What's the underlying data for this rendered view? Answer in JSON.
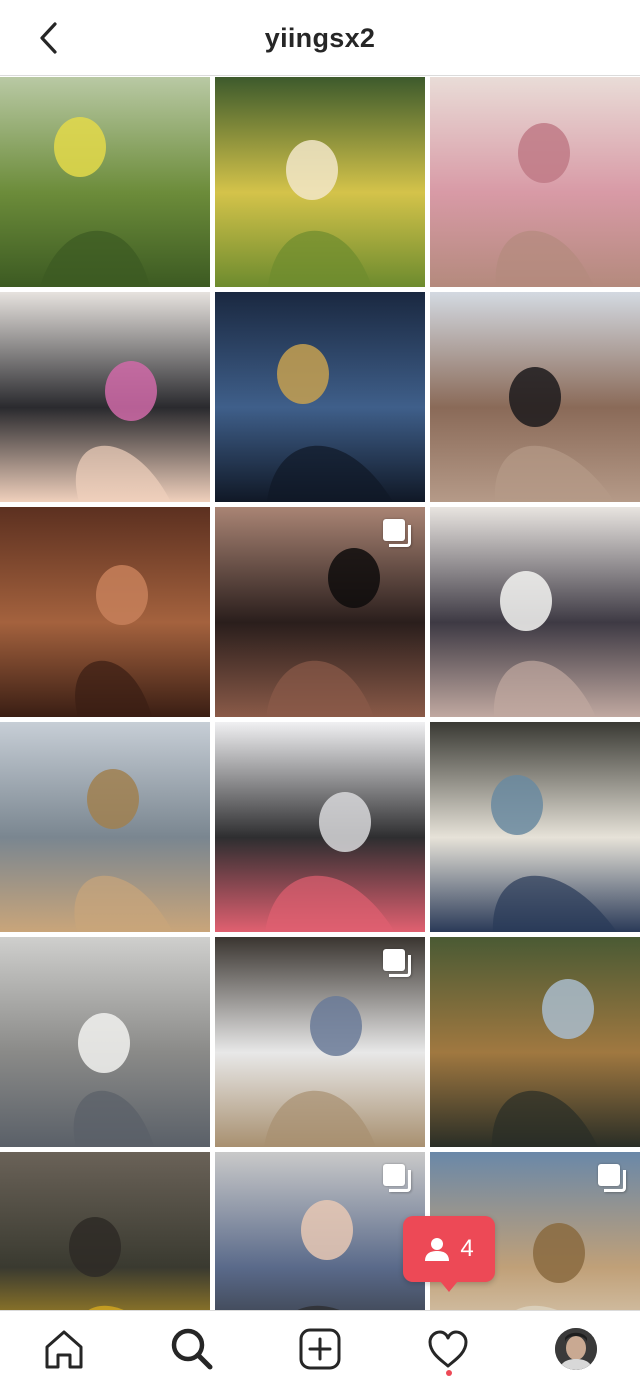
{
  "header": {
    "username": "yiingsx2"
  },
  "grid": {
    "posts": [
      {
        "alt": "",
        "multi": false,
        "colors": [
          "#b9c9a4",
          "#6c8c3a",
          "#e3d94a",
          "#3c5a22"
        ]
      },
      {
        "alt": "",
        "multi": false,
        "colors": [
          "#3d5a2c",
          "#d4c34a",
          "#f2e6c8",
          "#6d8b2e"
        ]
      },
      {
        "alt": "",
        "multi": false,
        "colors": [
          "#e9dcd7",
          "#d89aa6",
          "#c07a86",
          "#b48a7d"
        ]
      },
      {
        "alt": "",
        "multi": false,
        "colors": [
          "#e6e2de",
          "#2a2a2e",
          "#d06aa8",
          "#f0d0bc"
        ]
      },
      {
        "alt": "",
        "multi": false,
        "colors": [
          "#1a2840",
          "#3f5f8a",
          "#c5a050",
          "#101826"
        ]
      },
      {
        "alt": "",
        "multi": false,
        "colors": [
          "#d3d9e1",
          "#8a6a58",
          "#1c1a1c",
          "#b59a88"
        ]
      },
      {
        "alt": "",
        "multi": false,
        "colors": [
          "#5c3020",
          "#a4623e",
          "#c7805a",
          "#3a1e14"
        ]
      },
      {
        "alt": "",
        "multi": true,
        "colors": [
          "#a98474",
          "#2a1e1c",
          "#0e0c0c",
          "#8a5a48"
        ]
      },
      {
        "alt": "",
        "multi": false,
        "colors": [
          "#e8e4e0",
          "#3e3a44",
          "#f4f4f2",
          "#c0a8a0"
        ]
      },
      {
        "alt": "",
        "multi": false,
        "colors": [
          "#c7ced6",
          "#7a8690",
          "#a08050",
          "#c9a57a"
        ]
      },
      {
        "alt": "",
        "multi": false,
        "colors": [
          "#f0f0f2",
          "#2e2e30",
          "#d8d8da",
          "#e06070"
        ]
      },
      {
        "alt": "",
        "multi": false,
        "colors": [
          "#3a3a34",
          "#e6e2d8",
          "#6a8aa0",
          "#2a3a58"
        ]
      },
      {
        "alt": "",
        "multi": false,
        "colors": [
          "#cfcfcd",
          "#8a8a88",
          "#f2f2f0",
          "#5a6068"
        ]
      },
      {
        "alt": "",
        "multi": true,
        "colors": [
          "#3a3530",
          "#e8e8e8",
          "#6a7a98",
          "#a89070"
        ]
      },
      {
        "alt": "",
        "multi": false,
        "colors": [
          "#4a5a34",
          "#a07840",
          "#a9bccd",
          "#2a2e26"
        ]
      },
      {
        "alt": "",
        "multi": false,
        "colors": [
          "#6a6258",
          "#3a3a30",
          "#2e2a26",
          "#e0b020"
        ]
      },
      {
        "alt": "",
        "multi": true,
        "colors": [
          "#c9c9c9",
          "#5a6a8a",
          "#e8c8b4",
          "#2a2a2a"
        ]
      },
      {
        "alt": "",
        "multi": true,
        "colors": [
          "#6a88a8",
          "#c0a078",
          "#8a6a40",
          "#e0d8c8"
        ]
      }
    ]
  },
  "activity_badge": {
    "count": "4",
    "icon": "person-icon",
    "color": "#ed4956"
  },
  "tabbar": {
    "tabs": [
      {
        "name": "home",
        "icon": "home-icon"
      },
      {
        "name": "search",
        "icon": "search-icon",
        "active": true
      },
      {
        "name": "new-post",
        "icon": "plus-square-icon"
      },
      {
        "name": "activity",
        "icon": "heart-icon"
      },
      {
        "name": "profile",
        "icon": "avatar"
      }
    ]
  }
}
